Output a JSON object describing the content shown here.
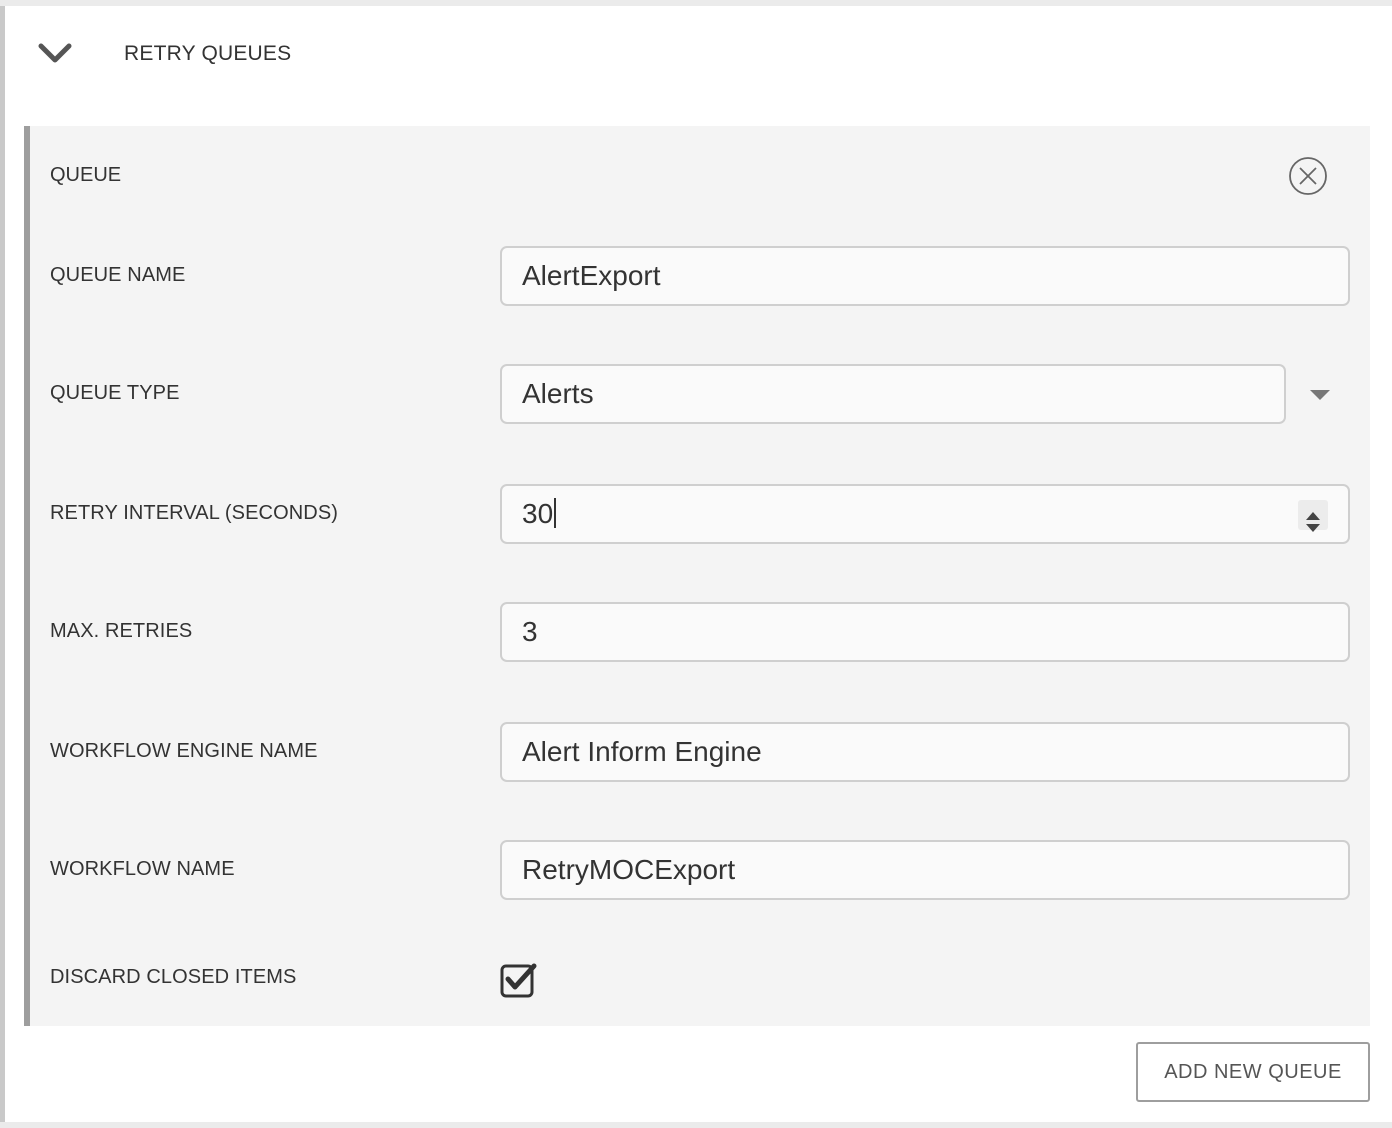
{
  "section": {
    "title": "RETRY QUEUES",
    "toggle_icon": "chevron-down-icon"
  },
  "queue": {
    "header_label": "QUEUE",
    "remove_icon": "close-circle-icon",
    "fields": {
      "queue_name": {
        "label": "QUEUE NAME",
        "value": "AlertExport"
      },
      "queue_type": {
        "label": "QUEUE TYPE",
        "value": "Alerts"
      },
      "retry_interval": {
        "label": "RETRY INTERVAL (SECONDS)",
        "value": "30"
      },
      "max_retries": {
        "label": "MAX. RETRIES",
        "value": "3"
      },
      "workflow_engine_name": {
        "label": "WORKFLOW ENGINE NAME",
        "value": "Alert Inform Engine"
      },
      "workflow_name": {
        "label": "WORKFLOW NAME",
        "value": "RetryMOCExport"
      },
      "discard_closed_items": {
        "label": "DISCARD CLOSED ITEMS",
        "checked": true
      }
    }
  },
  "actions": {
    "add_new_queue_label": "ADD NEW QUEUE"
  },
  "colors": {
    "card_background": "#f4f4f4",
    "card_accent_border": "#9e9e9e",
    "input_border": "#cfcfcf",
    "text": "#333333"
  }
}
